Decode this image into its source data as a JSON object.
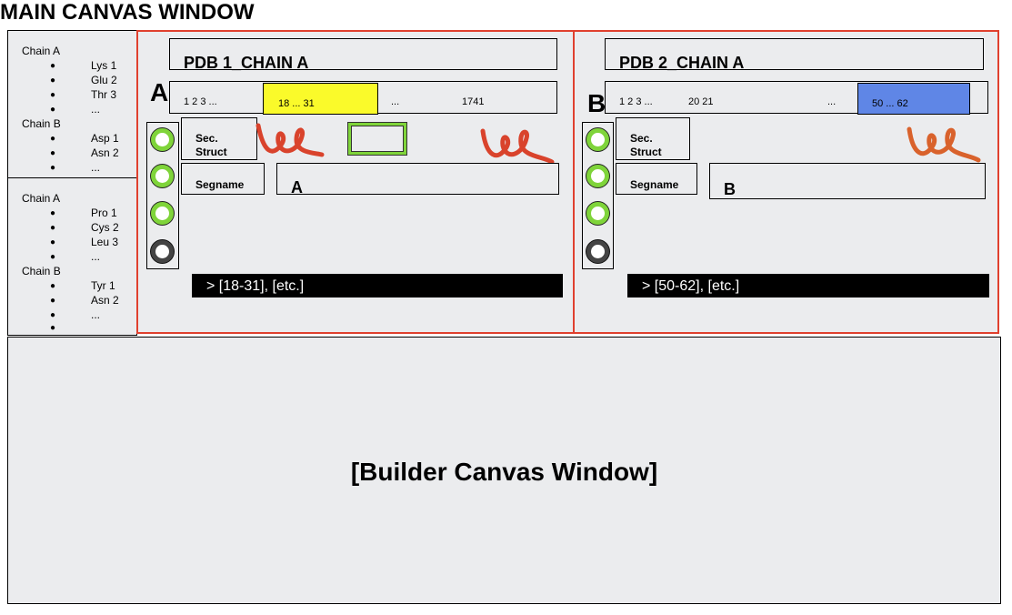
{
  "title": "MAIN CANVAS WINDOW",
  "sidebar": {
    "groups": [
      {
        "chains": [
          {
            "label": "Chain A",
            "items": [
              "Lys 1",
              "Glu 2",
              "Thr 3",
              "..."
            ]
          },
          {
            "label": "Chain B",
            "items": [
              "Asp 1",
              "Asn 2",
              "..."
            ]
          }
        ]
      },
      {
        "chains": [
          {
            "label": "Chain A",
            "items": [
              "Pro 1",
              "Cys 2",
              "Leu 3",
              "..."
            ]
          },
          {
            "label": "Chain B",
            "items": [
              "Tyr 1",
              "Asn 2",
              "...",
              ""
            ]
          }
        ]
      }
    ]
  },
  "panels": [
    {
      "letter": "A",
      "pdb_title": "PDB 1_CHAIN A",
      "seq_start": "1 2 3 ...",
      "seq_selected": "18 ... 31",
      "seq_ellipsis": "...",
      "seq_end": "1741",
      "highlight_color": "#fafa2a",
      "sec_struct_label": "Sec.\nStruct",
      "segname_label": "Segname",
      "segname_value": "A",
      "command": "> [18-31], [etc.]",
      "toggles": [
        "on",
        "on",
        "on",
        "off"
      ]
    },
    {
      "letter": "B",
      "pdb_title": "PDB 2_CHAIN A",
      "seq_start": "1 2 3 ...",
      "seq_mid": "20 21",
      "seq_ellipsis": "...",
      "seq_selected": "50 ... 62",
      "highlight_color": "#5f86e6",
      "sec_struct_label": "Sec.\nStruct",
      "segname_label": "Segname",
      "segname_value": "B",
      "command": "> [50-62], [etc.]",
      "toggles": [
        "on",
        "on",
        "on",
        "off"
      ]
    }
  ],
  "builder": {
    "label": "[Builder Canvas Window]"
  },
  "colors": {
    "panel_border": "#e0402e",
    "toggle_on": "#7fd43a",
    "toggle_off": "#444444",
    "squiggle_red": "#d9432c",
    "squiggle_orange": "#d9622c",
    "green_box": "#7fd43a"
  }
}
